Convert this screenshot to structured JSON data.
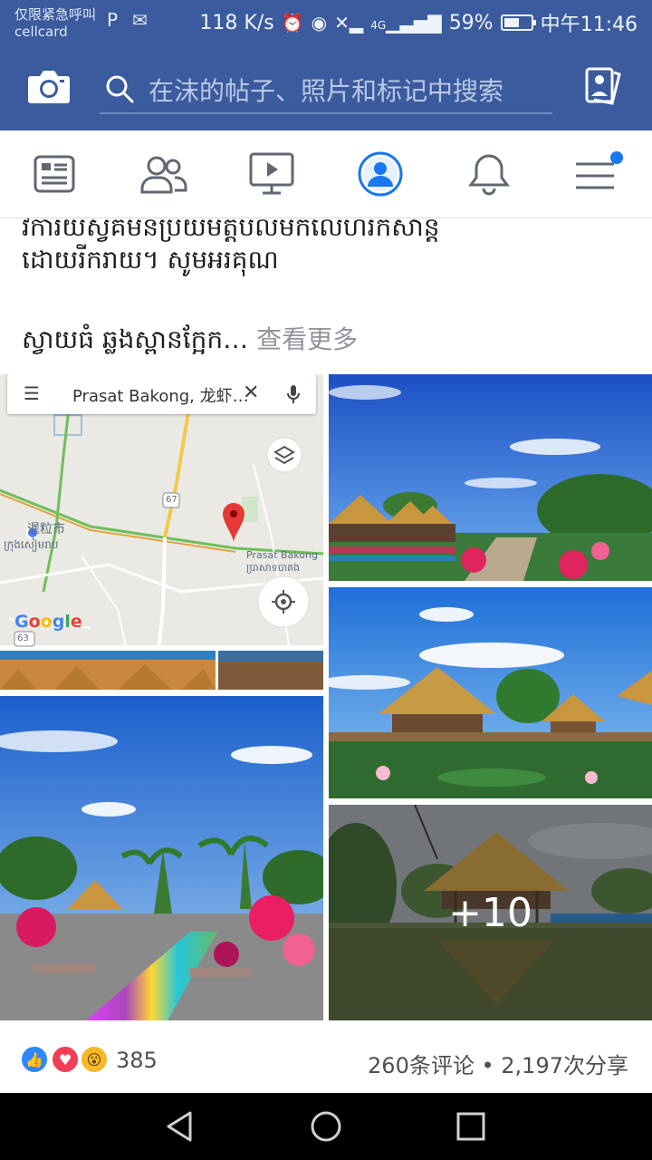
{
  "status_bar": {
    "carrier_line1": "仅限紧急呼叫",
    "carrier_line2": "cellcard",
    "net_speed": "118 K/s",
    "network": "4G",
    "battery": "59%",
    "battery_level": 0.59,
    "time": "中午11:46"
  },
  "header": {
    "search_placeholder": "在沫的帖子、照片和标记中搜索"
  },
  "nav": {
    "active_tab": "profile",
    "has_menu_badge": true
  },
  "post": {
    "text_line1": "វិការយស្វគមនប្រយមត្តបលមកលេហរកសាន្ត",
    "text_line2": "ដោយរីករាយ។ សូមអរគុណ",
    "text_line3": "ស្វាយធំ ឆ្លងស្ពានក្អែក…",
    "see_more": "查看更多"
  },
  "map": {
    "search_text": "Prasat Bakong, 龙虾…",
    "city_label_1": "暹粒市",
    "city_label_2": "ក្រុងសៀមរាប",
    "place_label_1": "Prasat Bakong",
    "place_label_2": "ប្រាសាទបាគង",
    "route_label_1": "67",
    "route_label_2": "63",
    "google_logo": "Google"
  },
  "photos": {
    "more_count": "+10"
  },
  "reactions": {
    "count": "385",
    "comments": "260条评论",
    "separator": "•",
    "shares": "2,197次分享"
  },
  "colors": {
    "brand": "#3b5b9e",
    "link": "#1877f2",
    "like": "#2d88ff",
    "love": "#f33e58",
    "wow": "#f7b928",
    "badge": "#1877f2"
  }
}
